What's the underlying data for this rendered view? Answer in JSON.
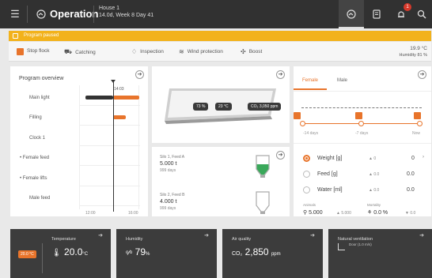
{
  "header": {
    "title": "Operation",
    "house_name": "House 1",
    "house_info": "14.0d, Week 8 Day 41",
    "notif_count": "1"
  },
  "alarm": {
    "text": "Program paused"
  },
  "toolbar": {
    "stop_flock": "Stop flock",
    "catching": "Catching",
    "inspection": "Inspection",
    "wind_protection": "Wind protection",
    "boost": "Boost",
    "temp_out": "19.9 °C",
    "humidity_out": "Humidity 81 %"
  },
  "program": {
    "title": "Program overview",
    "rows": [
      "Main light",
      "Filling",
      "Clock 1",
      "Female feed",
      "Female lifts",
      "Male feed"
    ],
    "marker": "14:03",
    "t_start": "12:00",
    "t_end": "16:00"
  },
  "silo_view": {
    "chip1": "73 %",
    "chip2": "23 °C",
    "chip3": "CO₂ 3,050 ppm"
  },
  "silos": [
    {
      "name": "Silo 1, Feed A",
      "amount": "5.000 t",
      "days": "999 days"
    },
    {
      "name": "Silo 2, Feed B",
      "amount": "4.000 t",
      "days": "999 days"
    }
  ],
  "growth": {
    "tabs": [
      "Female",
      "Male"
    ],
    "labels": [
      "-14 days",
      "-7 days",
      "Now"
    ],
    "rows": [
      {
        "label": "Weight [g]",
        "delta": "▲ 0",
        "value": "0"
      },
      {
        "label": "Feed [g]",
        "delta": "▲ 0.0",
        "value": "0.0"
      },
      {
        "label": "Water [ml]",
        "delta": "▲ 0.0",
        "value": "0.0"
      }
    ],
    "animals_label": "Animals",
    "animals_value": "5.000",
    "animals_delta": "▲ 5.000",
    "mortality_label": "Mortality",
    "mortality_value": "0.0 %",
    "mortality_delta": "▼ 0.0"
  },
  "environment": {
    "temperature_label": "Temperature",
    "temperature_value": "20.0",
    "temperature_unit": "°C",
    "temperature_badge": "20.0 °C",
    "humidity_label": "Humidity",
    "humidity_value": "79",
    "humidity_unit": "%",
    "air_label": "Air quality",
    "air_value": "2,850",
    "air_unit": "ppm",
    "vent_label": "Natural ventilation",
    "vent_sub": "Door (1.0 m/s)"
  },
  "colors": {
    "accent": "#e8742b",
    "alarm": "#f2b21c",
    "dark": "#313131",
    "green": "#3aa85a"
  }
}
